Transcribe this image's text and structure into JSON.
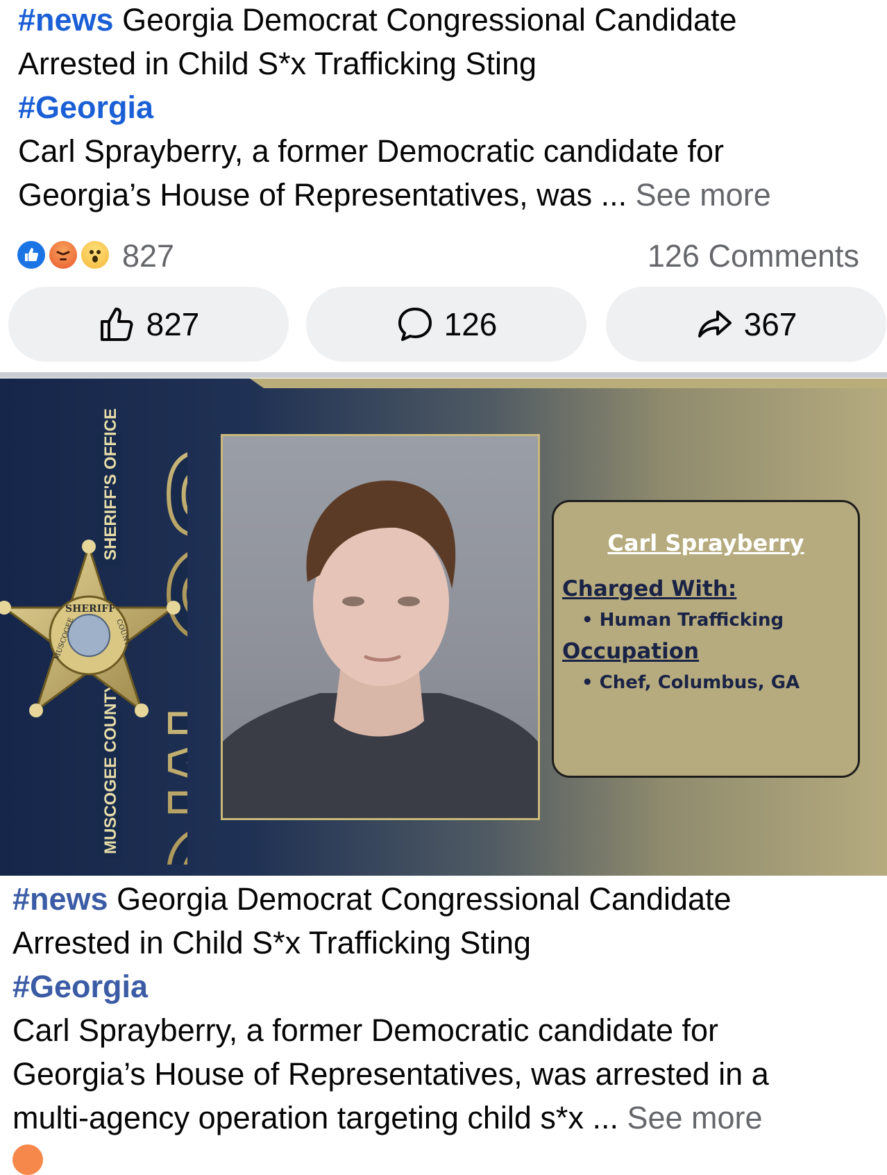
{
  "post1": {
    "hashtag_news": "#news",
    "headline_line1": "Georgia Democrat Congressional Candidate",
    "headline_line2": "Arrested in Child S*x Trafficking Sting",
    "hashtag_georgia": "#Georgia",
    "body_line1": "Carl Sprayberry, a former Democratic candidate for",
    "body_line2": "Georgia’s House of Representatives, was ...",
    "see_more": "See more"
  },
  "stats": {
    "reactions": [
      "like-icon",
      "angry-icon",
      "wow-icon"
    ],
    "reaction_count": "827",
    "comments": "126 Comments"
  },
  "actions": {
    "like_count": "827",
    "comment_count": "126",
    "share_count": "367"
  },
  "image": {
    "agency_vertical_top": "SHERIFF'S OFFICE",
    "agency_vertical_bottom": "MUSCOGEE COUNTY",
    "letters_top": "SO",
    "letters_bottom": "MC",
    "badge_text_top": "SHERIFF",
    "badge_text_left": "MUSCOGEE",
    "badge_text_right": "COUNTY",
    "name": "Carl Sprayberry",
    "charged_heading": "Charged With:",
    "charge": "• Human Trafficking",
    "occupation_heading": "Occupation",
    "occupation": "• Chef, Columbus, GA"
  },
  "post2": {
    "hashtag_news": "#news",
    "headline_line1": "Georgia Democrat Congressional Candidate",
    "headline_line2": "Arrested in Child S*x Trafficking Sting",
    "hashtag_georgia": "#Georgia",
    "body_line1": "Carl Sprayberry, a former Democratic candidate for",
    "body_line2": "Georgia’s House of Representatives, was arrested in a",
    "body_line3": "multi-agency operation targeting child s*x ...",
    "see_more": "See more"
  },
  "colors": {
    "hashtag": "#1b5fd6",
    "hashtag_dim": "#3b5ba5",
    "muted": "#65676b",
    "button_bg": "#eff0f2",
    "gold": "#b6ab7e",
    "navy": "#16264a"
  }
}
